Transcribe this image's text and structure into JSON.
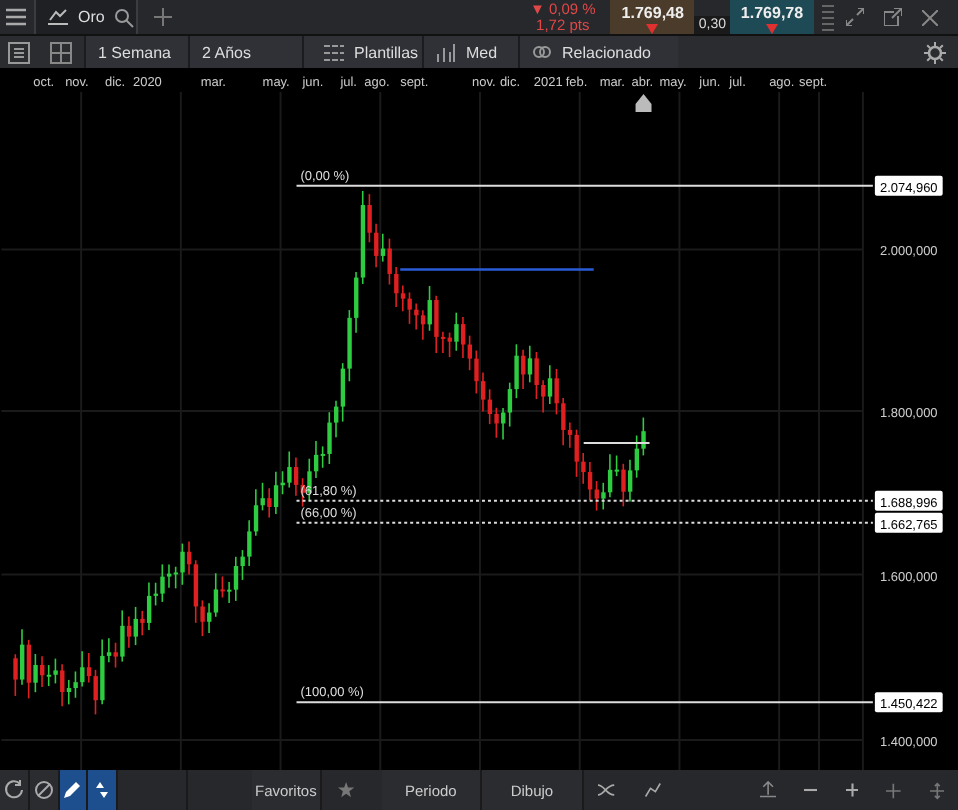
{
  "tab": {
    "title": "Oro"
  },
  "quote": {
    "change_percent": "▼ 0,09 %",
    "change_points": "1,72 pts",
    "bid": "1.769,48",
    "ask": "1.769,78",
    "spread": "0,30"
  },
  "controls": [
    {
      "label": "1 Semana"
    },
    {
      "label": "2 Años"
    },
    {
      "label": "Plantillas"
    },
    {
      "label": "Med"
    },
    {
      "label": "Relacionado"
    }
  ],
  "time_axis": [
    "oct.",
    "nov.",
    "dic.",
    "2020",
    "mar.",
    "may.",
    "jun.",
    "jul.",
    "ago.",
    "sept.",
    "nov.",
    "dic.",
    "2021",
    "feb.",
    "mar.",
    "abr.",
    "may.",
    "jun.",
    "jul.",
    "ago.",
    "sept."
  ],
  "price_axis": [
    "2.000,000",
    "1.800,000",
    "1.600,000",
    "1.400,000"
  ],
  "fib_levels": [
    {
      "label": "(0,00 %)",
      "price": "2.074,960"
    },
    {
      "label": "(61,80 %)",
      "price": "1.688,996"
    },
    {
      "label": "(66,00 %)",
      "price": "1.662,765"
    },
    {
      "label": "(100,00 %)",
      "price": "1.450,422"
    }
  ],
  "tools": [
    {
      "selected": false
    },
    {
      "selected": false
    },
    {
      "selected": true
    },
    {
      "selected": true
    }
  ],
  "bottom_bar": {
    "favorites": "Favoritos",
    "period": "Periodo",
    "drawing": "Dibujo"
  }
}
